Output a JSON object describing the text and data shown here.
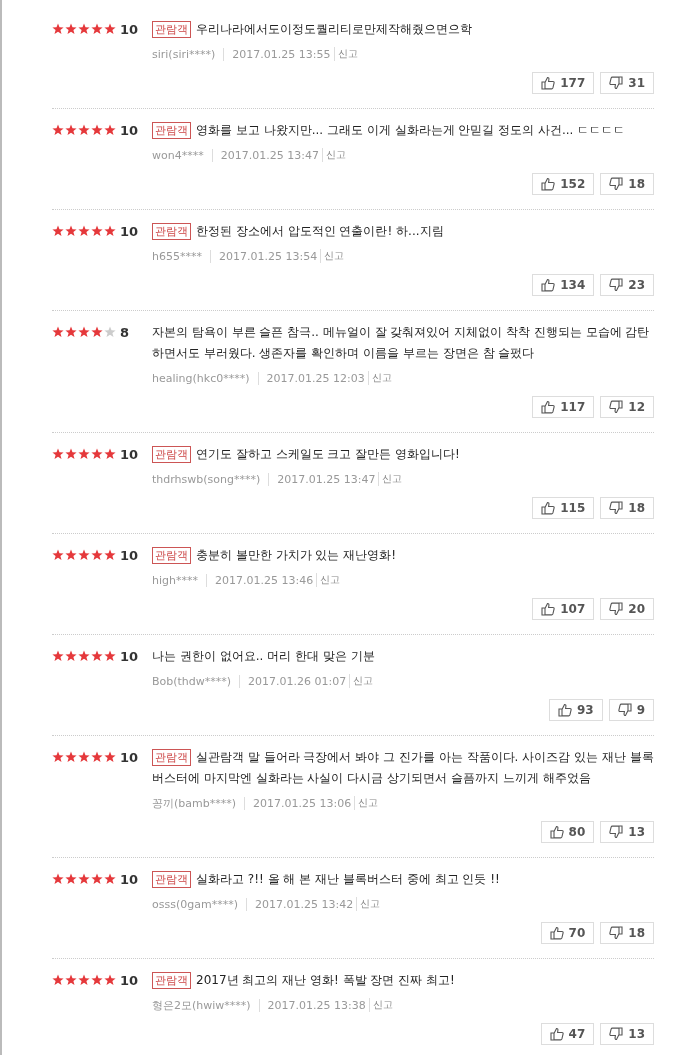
{
  "reviews": [
    {
      "stars": 5,
      "score": "10",
      "badge": "관람객",
      "text": "우리나라에서도이정도퀄리티로만제작해줬으면으학",
      "author": "siri(siri****)",
      "date": "2017.01.25 13:55",
      "report": "신고",
      "likes": "177",
      "dislikes": "31"
    },
    {
      "stars": 5,
      "score": "10",
      "badge": "관람객",
      "text": "영화를 보고 나왔지만... 그래도 이게 실화라는게 안믿길 정도의 사건... ㄷㄷㄷㄷ",
      "author": "won4****",
      "date": "2017.01.25 13:47",
      "report": "신고",
      "likes": "152",
      "dislikes": "18"
    },
    {
      "stars": 5,
      "score": "10",
      "badge": "관람객",
      "text": "한정된 장소에서 압도적인 연출이란! 하...지림",
      "author": "h655****",
      "date": "2017.01.25 13:54",
      "report": "신고",
      "likes": "134",
      "dislikes": "23"
    },
    {
      "stars": 4,
      "score": "8",
      "text": "자본의 탐욕이 부른 슬픈 참극.. 메뉴얼이 잘 갖춰져있어 지체없이 착착 진행되는 모습에 감탄하면서도 부러웠다. 생존자를 확인하며 이름을 부르는 장면은 참 슬펐다",
      "author": "healing(hkc0****)",
      "date": "2017.01.25 12:03",
      "report": "신고",
      "likes": "117",
      "dislikes": "12"
    },
    {
      "stars": 5,
      "score": "10",
      "badge": "관람객",
      "text": "연기도 잘하고 스케일도 크고 잘만든 영화입니다!",
      "author": "thdrhswb(song****)",
      "date": "2017.01.25 13:47",
      "report": "신고",
      "likes": "115",
      "dislikes": "18"
    },
    {
      "stars": 5,
      "score": "10",
      "badge": "관람객",
      "text": "충분히 볼만한 가치가 있는 재난영화!",
      "author": "high****",
      "date": "2017.01.25 13:46",
      "report": "신고",
      "likes": "107",
      "dislikes": "20"
    },
    {
      "stars": 5,
      "score": "10",
      "text": "나는 권한이 없어요.. 머리 한대 맞은 기분",
      "author": "Bob(thdw****)",
      "date": "2017.01.26 01:07",
      "report": "신고",
      "likes": "93",
      "dislikes": "9"
    },
    {
      "stars": 5,
      "score": "10",
      "badge": "관람객",
      "text": "실관람객 말 들어라 극장에서 봐야 그 진가를 아는 작품이다. 사이즈감 있는 재난 블록버스터에 마지막엔 실화라는 사실이 다시금 상기되면서 슬픔까지 느끼게 해주었음",
      "author": "꽁끼(bamb****)",
      "date": "2017.01.25 13:06",
      "report": "신고",
      "likes": "80",
      "dislikes": "13"
    },
    {
      "stars": 5,
      "score": "10",
      "badge": "관람객",
      "text": "실화라고 ?!! 올 해 본 재난 블록버스터 중에 최고 인듯 !!",
      "author": "osss(0gam****)",
      "date": "2017.01.25 13:42",
      "report": "신고",
      "likes": "70",
      "dislikes": "18"
    },
    {
      "stars": 5,
      "score": "10",
      "badge": "관람객",
      "text": "2017년 최고의 재난 영화! 폭발 장면 진짜 최고!",
      "author": "형은2모(hwiw****)",
      "date": "2017.01.25 13:38",
      "report": "신고",
      "likes": "47",
      "dislikes": "13"
    }
  ]
}
